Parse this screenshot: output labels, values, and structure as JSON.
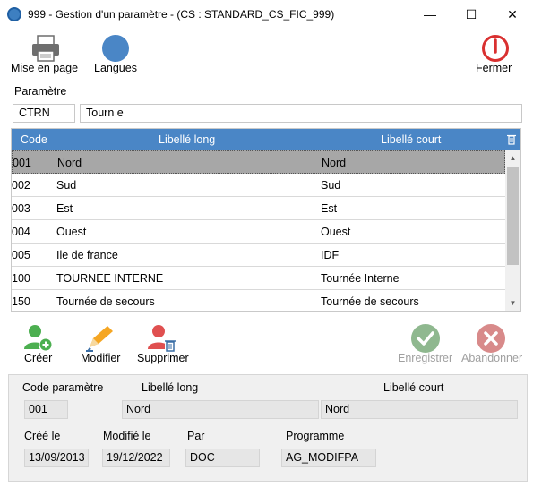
{
  "window": {
    "title": "999 - Gestion d'un paramètre - (CS : STANDARD_CS_FIC_999)",
    "minimize": "—",
    "maximize": "☐",
    "close": "✕"
  },
  "toolbar": {
    "print_label": "Mise en page",
    "languages_label": "Langues",
    "close_label": "Fermer"
  },
  "parameter": {
    "section_label": "Paramètre",
    "code": "CTRN",
    "name": "Tourn e"
  },
  "grid": {
    "headers": {
      "code": "Code",
      "long": "Libellé long",
      "short": "Libellé court"
    },
    "rows": [
      {
        "code": "001",
        "long": "Nord",
        "short": "Nord"
      },
      {
        "code": "002",
        "long": "Sud",
        "short": "Sud"
      },
      {
        "code": "003",
        "long": "Est",
        "short": "Est"
      },
      {
        "code": "004",
        "long": "Ouest",
        "short": "Ouest"
      },
      {
        "code": "005",
        "long": "Ile de france",
        "short": "IDF"
      },
      {
        "code": "100",
        "long": "TOURNEE INTERNE",
        "short": "Tournée Interne"
      },
      {
        "code": "150",
        "long": "Tournée de secours",
        "short": "Tournée de secours"
      }
    ],
    "selected_index": 0
  },
  "actions": {
    "create": "Créer",
    "modify": "Modifier",
    "delete": "Supprimer",
    "save": "Enregistrer",
    "cancel": "Abandonner"
  },
  "detail": {
    "code_label": "Code paramètre",
    "long_label": "Libellé long",
    "short_label": "Libellé court",
    "code_value": "001",
    "long_value": "Nord",
    "short_value": "Nord",
    "created_label": "Créé le",
    "modified_label": "Modifié le",
    "by_label": "Par",
    "program_label": "Programme",
    "created_value": "13/09/2013",
    "modified_value": "19/12/2022",
    "by_value": "DOC",
    "program_value": "AG_MODIFPA"
  },
  "colors": {
    "header_blue": "#4a86c6",
    "create_green": "#4caf50",
    "delete_red": "#e05050",
    "disabled_gray": "#a0a0a0",
    "close_red": "#d93030"
  }
}
